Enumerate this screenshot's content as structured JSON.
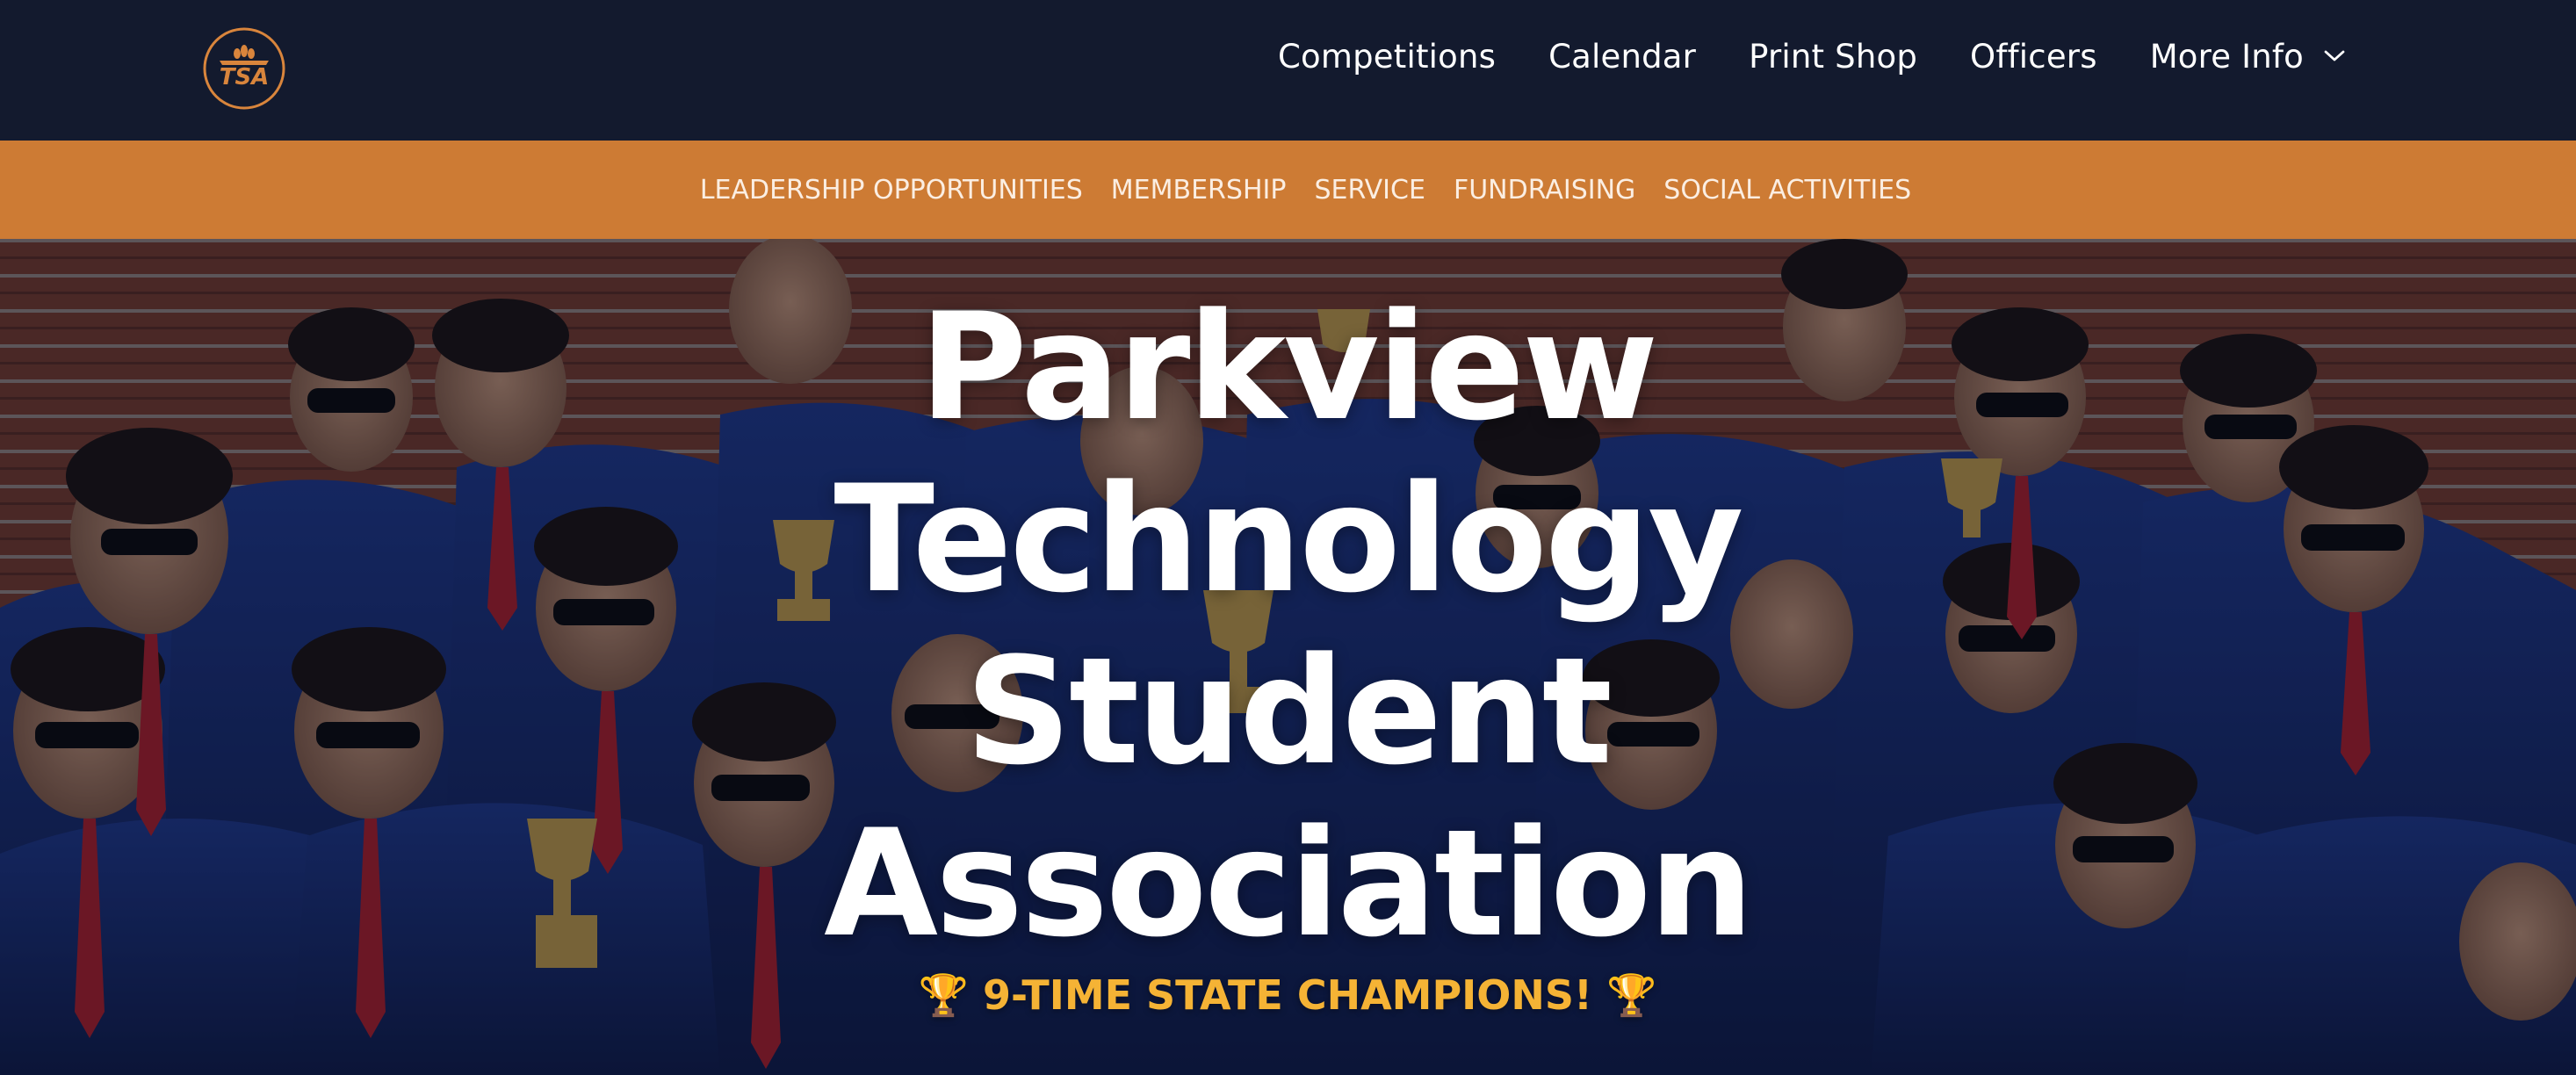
{
  "brand": {
    "logo_text": "TSA",
    "logo_icon": "tsa-logo",
    "accent_color": "#cd7b34",
    "nav_bg_color": "#131a2e"
  },
  "nav": {
    "items": [
      {
        "label": "Competitions"
      },
      {
        "label": "Calendar"
      },
      {
        "label": "Print Shop"
      },
      {
        "label": "Officers"
      },
      {
        "label": "More Info",
        "icon": "chevron-down-icon"
      }
    ]
  },
  "subnav": {
    "items": [
      {
        "label": "LEADERSHIP OPPORTUNITIES"
      },
      {
        "label": "MEMBERSHIP"
      },
      {
        "label": "SERVICE"
      },
      {
        "label": "FUNDRAISING"
      },
      {
        "label": "SOCIAL ACTIVITIES"
      }
    ]
  },
  "hero": {
    "title_lines": [
      "Parkview",
      "Technology",
      "Student",
      "Association"
    ],
    "tagline": "🏆 9-TIME STATE CHAMPIONS! 🏆",
    "tagline_color": "#f5b335",
    "background": "group-photo"
  }
}
